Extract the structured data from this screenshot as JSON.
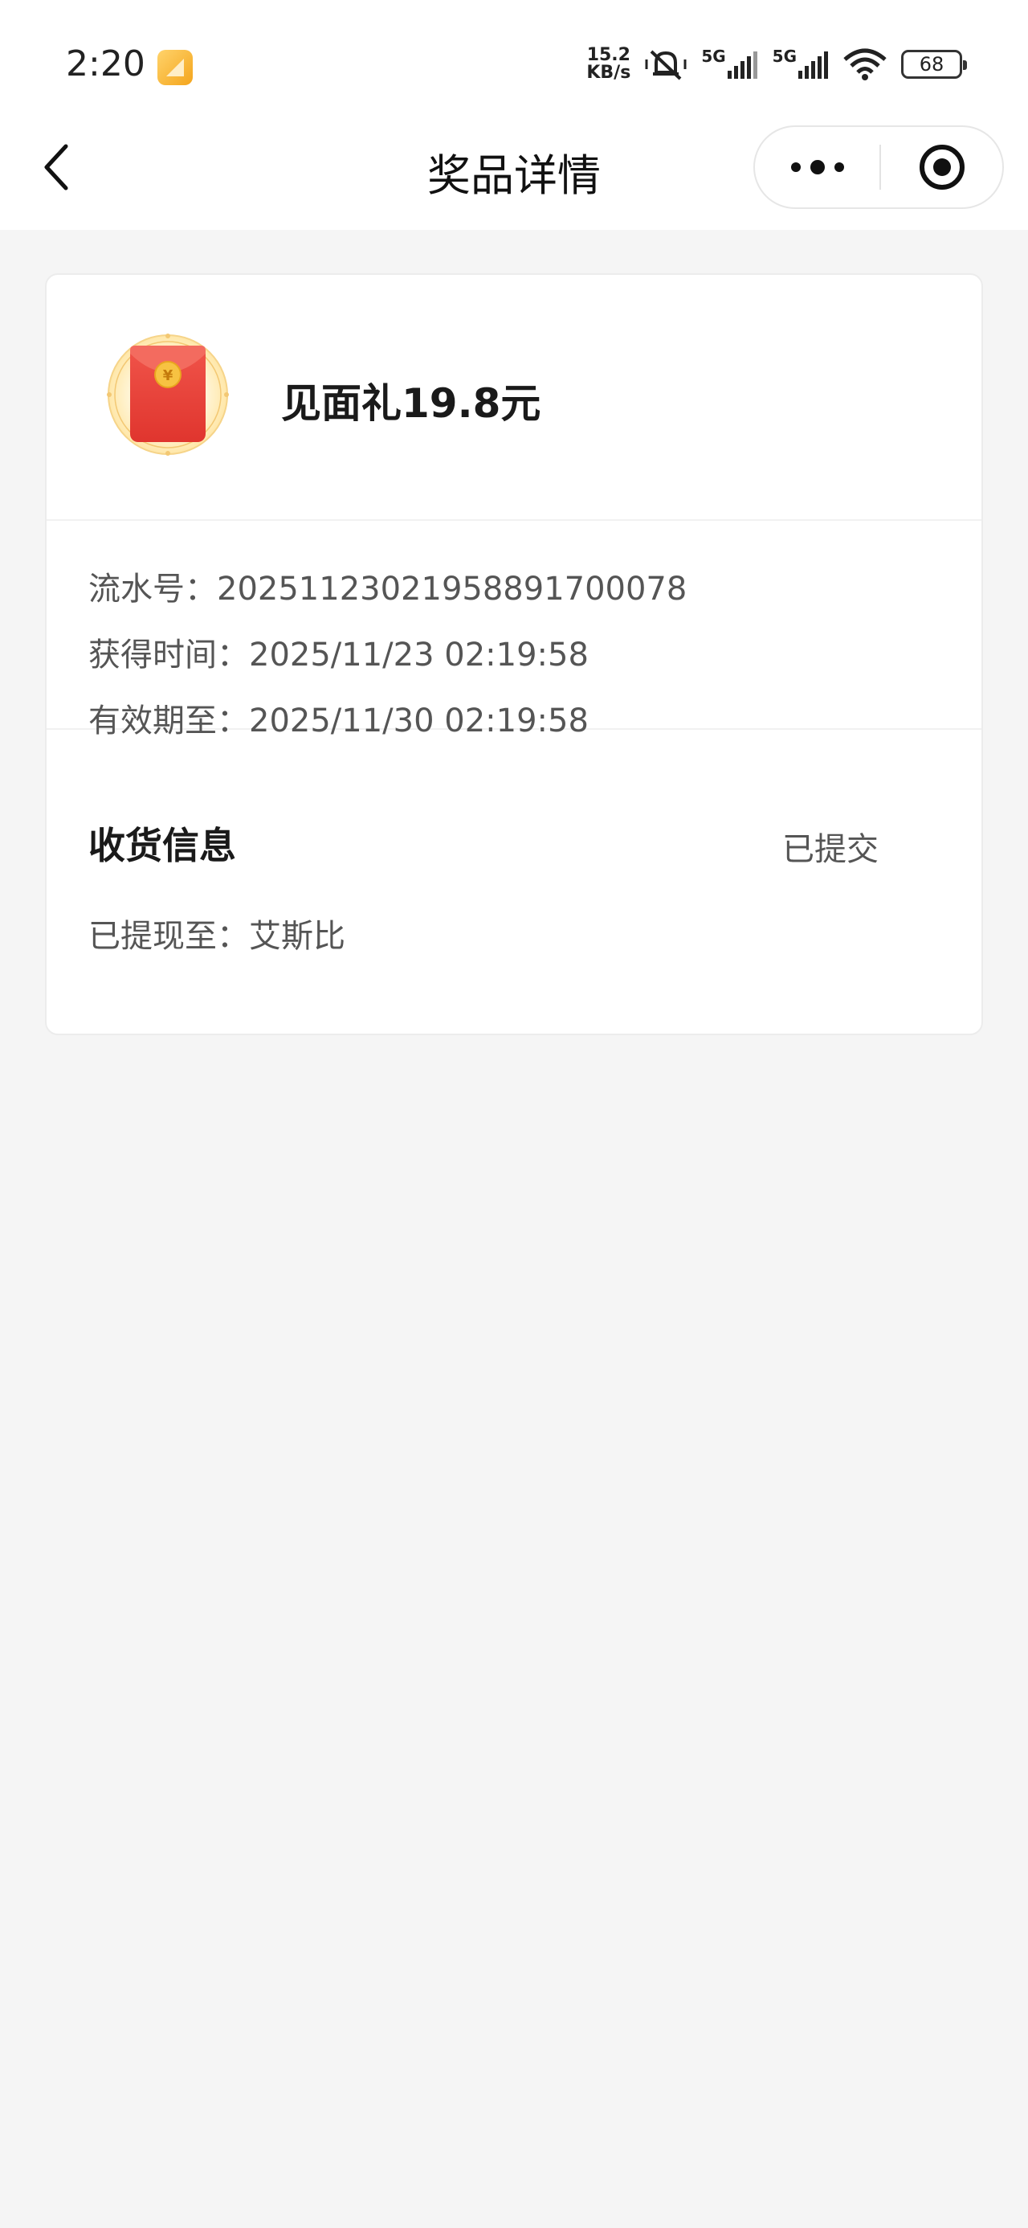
{
  "status_bar": {
    "time": "2:20",
    "net_speed_value": "15.2",
    "net_speed_unit": "KB/s",
    "sim1_label": "5G",
    "sim2_label": "5G",
    "battery": "68"
  },
  "nav": {
    "title": "奖品详情"
  },
  "prize": {
    "name": "见面礼19.8元",
    "icon": "red-envelope-icon"
  },
  "info": {
    "serial_label": "流水号：",
    "serial_value": "2025112302195889170007​8",
    "obtained_label": "获得时间：",
    "obtained_value": "2025/11/23 02:19:58",
    "expire_label": "有效期至：",
    "expire_value": "2025/11/30 02:19:58"
  },
  "shipping": {
    "title": "收货信息",
    "status": "已提交",
    "withdraw_label": "已提现至：",
    "withdraw_value": "艾斯比"
  },
  "colors": {
    "page_bg": "#f5f5f5",
    "card_bg": "#ffffff",
    "envelope_red": "#e8423a",
    "coin_gold": "#f5b92e"
  }
}
